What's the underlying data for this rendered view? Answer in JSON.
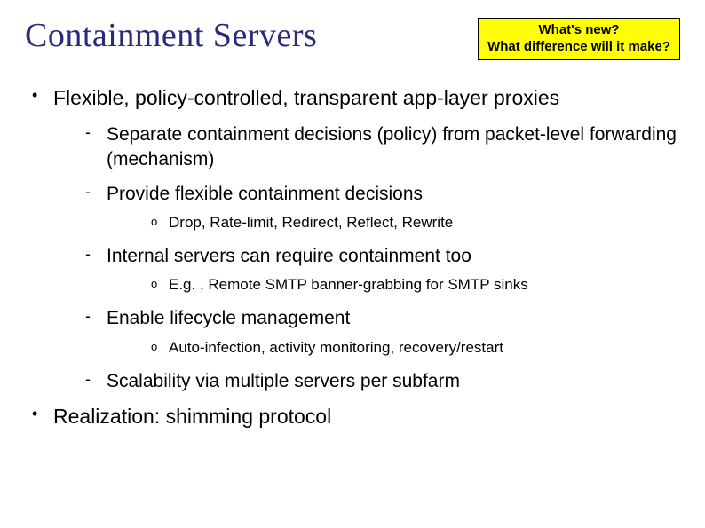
{
  "title": "Containment Servers",
  "callout": {
    "line1": "What's new?",
    "line2": "What difference will it make?"
  },
  "bullets": [
    {
      "text": "Flexible, policy-controlled, transparent app-layer proxies",
      "children": [
        {
          "text": "Separate containment decisions (policy) from packet-level forwarding (mechanism)"
        },
        {
          "text": "Provide flexible containment decisions",
          "children": [
            {
              "text": "Drop, Rate-limit, Redirect, Reflect, Rewrite"
            }
          ]
        },
        {
          "text": "Internal servers can require containment too",
          "children": [
            {
              "text": "E.g. , Remote SMTP banner-grabbing for SMTP sinks"
            }
          ]
        },
        {
          "text": "Enable lifecycle management",
          "children": [
            {
              "text": "Auto-infection, activity monitoring, recovery/restart"
            }
          ]
        },
        {
          "text": "Scalability via multiple servers per subfarm"
        }
      ]
    },
    {
      "text": "Realization: shimming protocol"
    }
  ]
}
